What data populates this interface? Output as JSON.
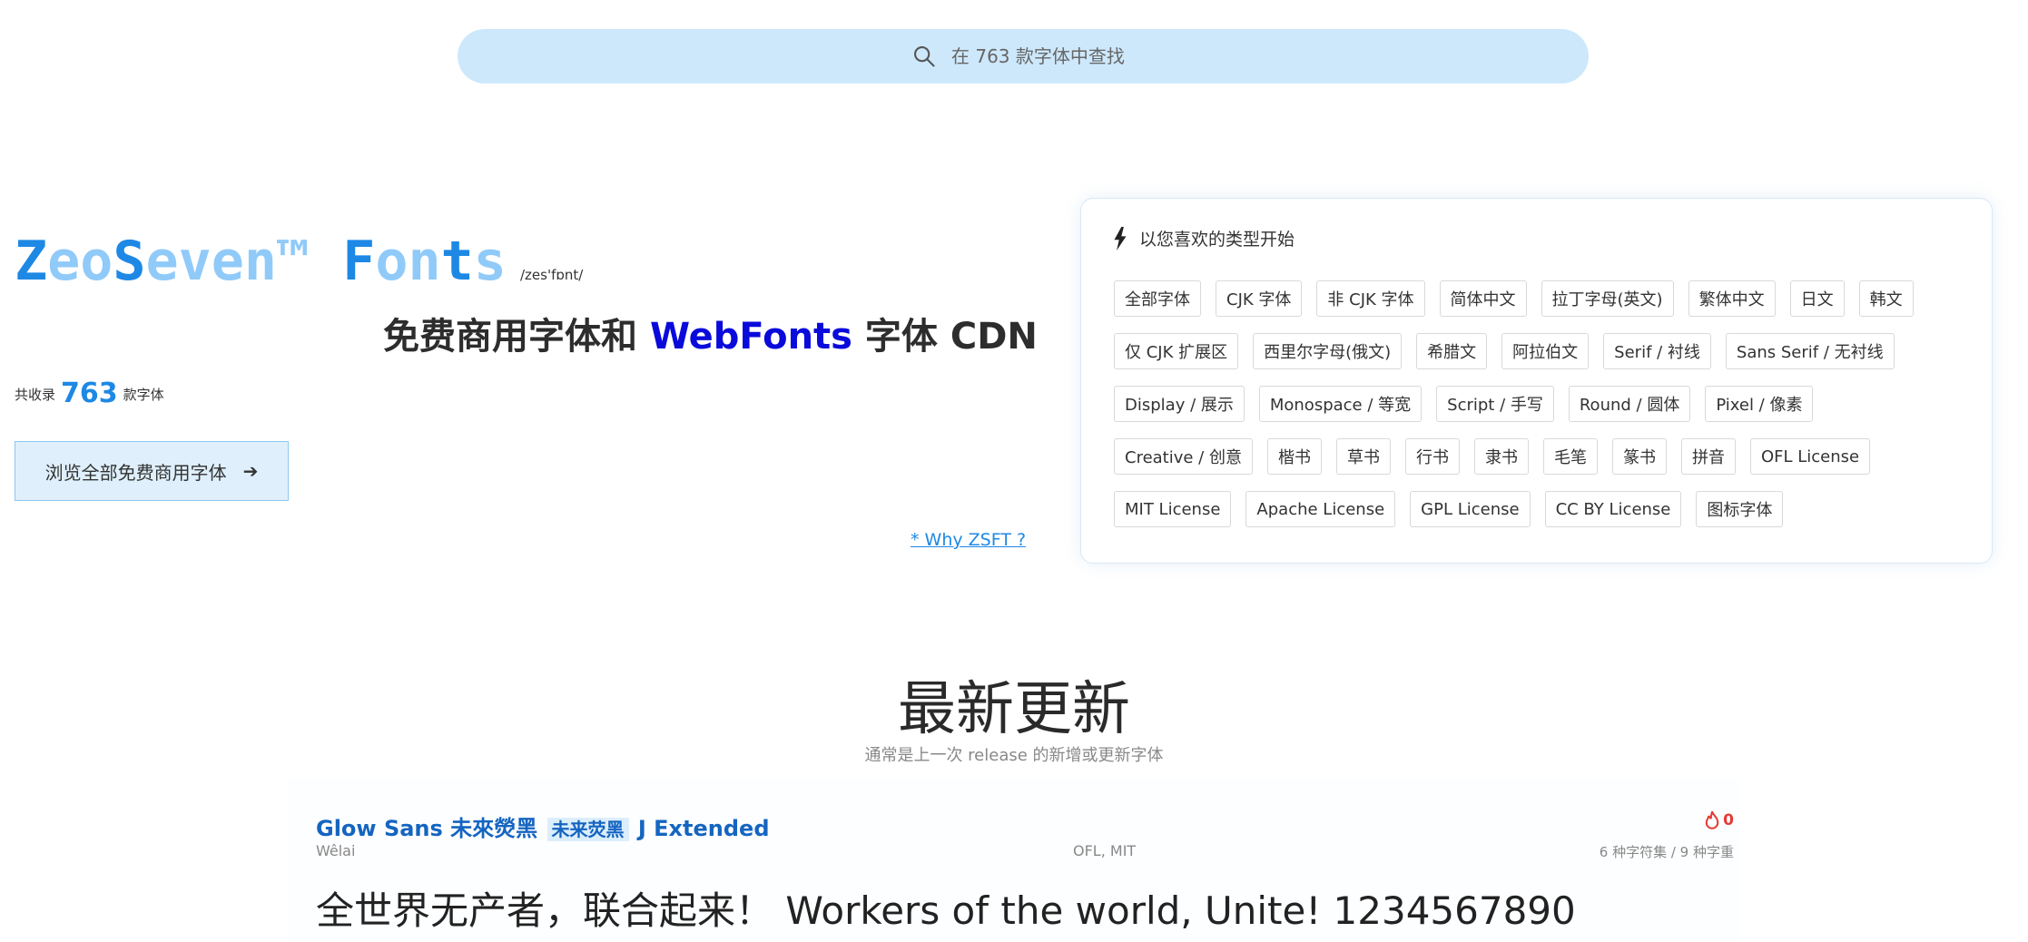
{
  "search": {
    "placeholder": "在 763 款字体中查找"
  },
  "hero": {
    "logo": {
      "z": "Z",
      "eo": "eo",
      "s": "S",
      "even": "even",
      "tm": "™",
      "f": "F",
      "on": "on",
      "t": "t",
      "s2": "s"
    },
    "phonetic": "/zes'fɒnt/",
    "tagline_pre": "免费商用字体和",
    "tagline_wf": "WebFonts",
    "tagline_post": "字体 CDN",
    "count_pre": "共收录",
    "count_num": "763",
    "count_post": "款字体",
    "browse_label": "浏览全部免费商用字体",
    "why_link": "* Why ZSFT ?"
  },
  "categories": {
    "heading": "以您喜欢的类型开始",
    "tags": [
      "全部字体",
      "CJK 字体",
      "非 CJK 字体",
      "简体中文",
      "拉丁字母(英文)",
      "繁体中文",
      "日文",
      "韩文",
      "仅 CJK 扩展区",
      "西里尔字母(俄文)",
      "希腊文",
      "阿拉伯文",
      "Serif / 衬线",
      "Sans Serif / 无衬线",
      "Display / 展示",
      "Monospace / 等宽",
      "Script / 手写",
      "Round / 圆体",
      "Pixel / 像素",
      "Creative / 创意",
      "楷书",
      "草书",
      "行书",
      "隶书",
      "毛笔",
      "篆书",
      "拼音",
      "OFL License",
      "MIT License",
      "Apache License",
      "GPL License",
      "CC BY License",
      "图标字体"
    ]
  },
  "latest": {
    "title": "最新更新",
    "subtitle": "通常是上一次 release 的新增或更新字体",
    "font": {
      "name_pre": "Glow Sans 未來熒黑",
      "name_hl": "未来荧黑",
      "name_post": "J Extended",
      "author": "Wêlai",
      "license": "OFL, MIT",
      "meta": "6 种字符集 / 9 种字重",
      "hot_count": "0",
      "preview": "全世界无产者，联合起来！ Workers of the world, Unite! 1234567890"
    }
  },
  "colors": {
    "accent": "#1e88e5",
    "accent_light": "#90caf9",
    "search_bg": "#cde8fb",
    "webfonts": "#0a0adb",
    "hot": "#e53935"
  }
}
